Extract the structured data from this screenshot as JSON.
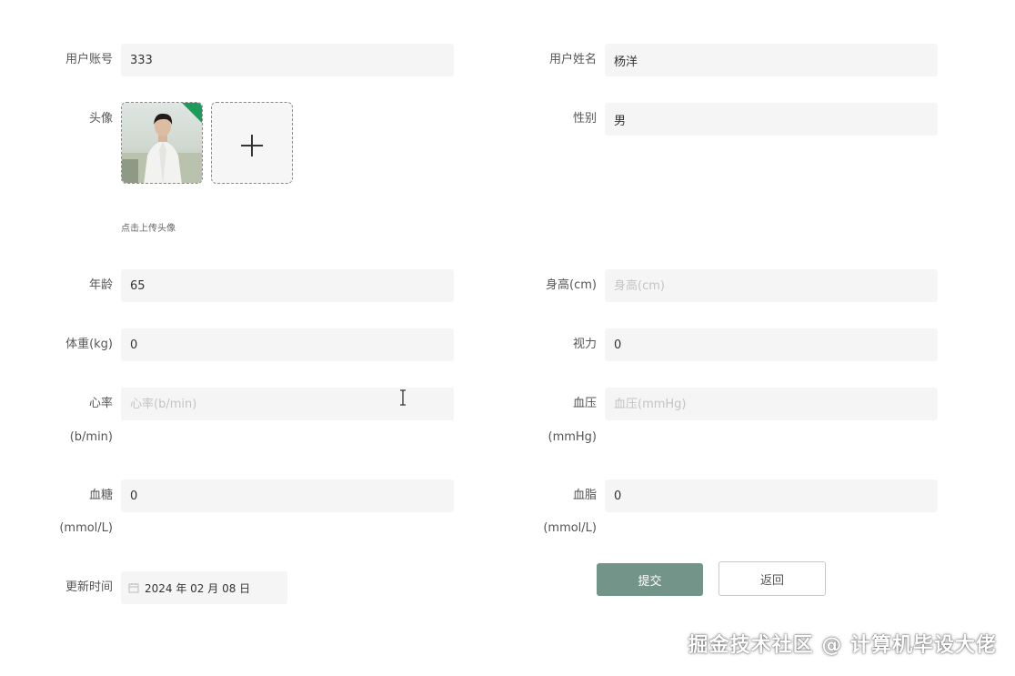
{
  "form": {
    "account": {
      "label": "用户账号",
      "value": "333"
    },
    "name": {
      "label": "用户姓名",
      "value": "杨洋"
    },
    "avatar": {
      "label": "头像",
      "hint": "点击上传头像"
    },
    "gender": {
      "label": "性别",
      "value": "男"
    },
    "age": {
      "label": "年龄",
      "value": "65"
    },
    "height": {
      "label": "身高(cm)",
      "value": "",
      "placeholder": "身高(cm)"
    },
    "weight": {
      "label": "体重(kg)",
      "value": "0"
    },
    "vision": {
      "label": "视力",
      "value": "0"
    },
    "heart_rate": {
      "label_line1": "心率",
      "label_line2": "(b/min)",
      "value": "",
      "placeholder": "心率(b/min)"
    },
    "blood_pressure": {
      "label_line1": "血压",
      "label_line2": "(mmHg)",
      "value": "",
      "placeholder": "血压(mmHg)"
    },
    "blood_sugar": {
      "label_line1": "血糖",
      "label_line2": "(mmol/L)",
      "value": "0"
    },
    "blood_lipid": {
      "label_line1": "血脂",
      "label_line2": "(mmol/L)",
      "value": "0"
    },
    "update_time": {
      "label": "更新时间",
      "value": "2024 年 02 月 08 日"
    }
  },
  "buttons": {
    "submit": "提交",
    "back": "返回"
  },
  "watermark": "掘金技术社区 @ 计算机毕设大佬",
  "colors": {
    "primary": "#739488",
    "field_bg": "#f5f5f5"
  },
  "icons": {
    "calendar": "calendar-icon",
    "plus": "plus-icon",
    "cursor": "text-cursor-icon"
  }
}
